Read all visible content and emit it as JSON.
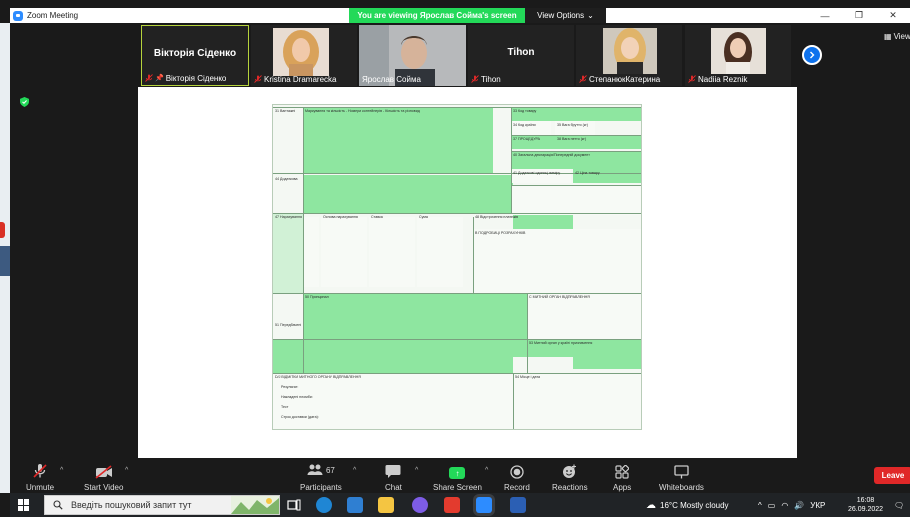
{
  "window": {
    "title": "Zoom Meeting",
    "share_banner": "You are viewing Ярослав Сойма's screen",
    "view_options": "View Options",
    "right_view_label": "View"
  },
  "participants": [
    {
      "name": "Вікторія Сіденко",
      "display": "Вікторія Сіденко",
      "video": false,
      "active": true,
      "pinned": true
    },
    {
      "name": "Kristina Dramarecka",
      "video": true
    },
    {
      "name": "Ярослав Сойма",
      "video": true
    },
    {
      "name": "Tihon",
      "display": "Tihon",
      "video": false
    },
    {
      "name": "СтепанюкКатерина",
      "video": true
    },
    {
      "name": "Nadiia Reznik",
      "video": true
    }
  ],
  "toolbar": {
    "unmute": "Unmute",
    "start_video": "Start Video",
    "participants": "Participants",
    "participants_count": "67",
    "chat": "Chat",
    "share_screen": "Share Screen",
    "record": "Record",
    "reactions": "Reactions",
    "apps": "Apps",
    "whiteboards": "Whiteboards",
    "leave": "Leave"
  },
  "taskbar": {
    "search_placeholder": "Введіть пошуковий запит тут",
    "weather": "16°C  Mostly cloudy",
    "language": "УКР",
    "time": "16:08",
    "date": "26.09.2022"
  },
  "colors": {
    "accent": "#0e72ed",
    "share_green": "#23d959",
    "leave_red": "#e02828",
    "form_green": "#8ee6a0"
  }
}
